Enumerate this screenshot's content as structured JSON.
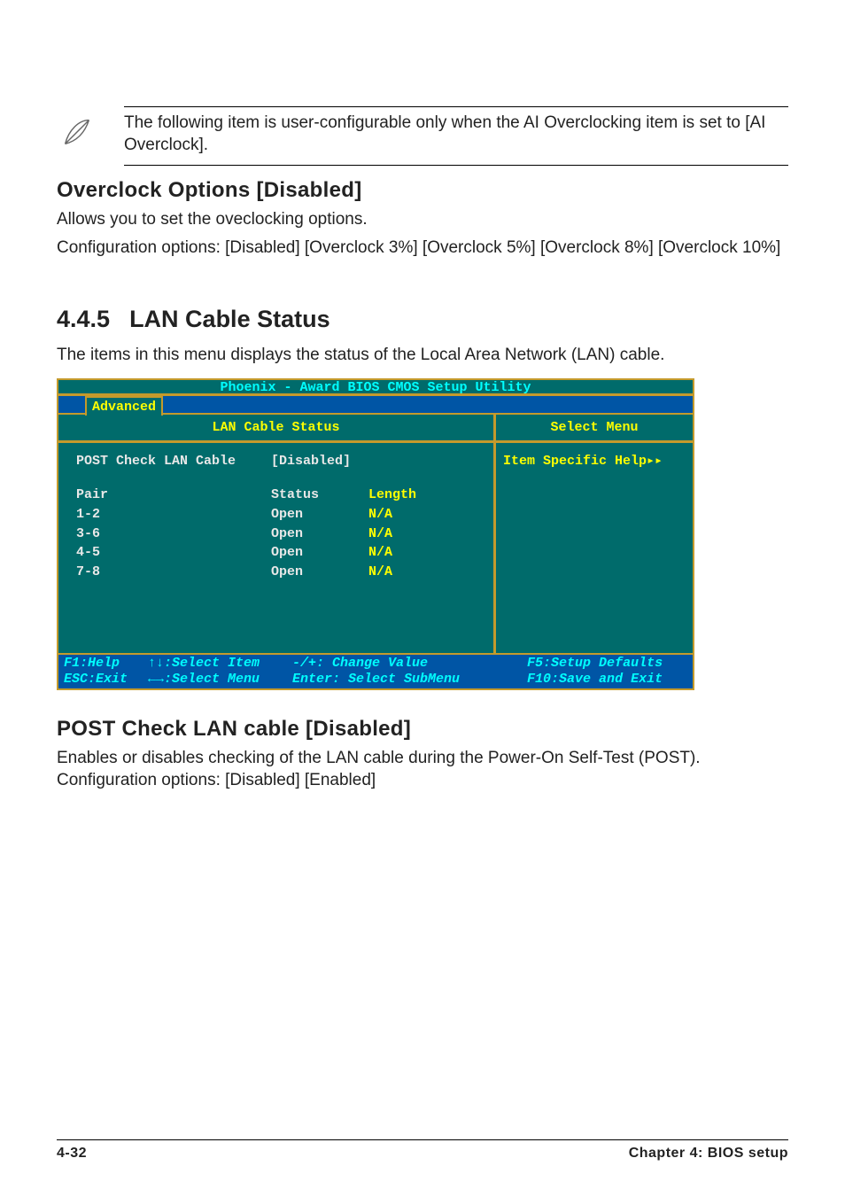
{
  "note": {
    "text": "The following item is user-configurable only when the AI Overclocking item is set to [AI Overclock]."
  },
  "overclock": {
    "heading": "Overclock Options [Disabled]",
    "body1": "Allows you to set the oveclocking options.",
    "body2": "Configuration options: [Disabled] [Overclock 3%] [Overclock 5%] [Overclock 8%] [Overclock 10%]"
  },
  "section": {
    "num": "4.4.5",
    "title": "LAN Cable Status",
    "intro": "The items in this menu displays the status of the Local Area Network (LAN) cable."
  },
  "bios": {
    "top": "Phoenix - Award BIOS CMOS Setup Utility",
    "active_tab": "Advanced",
    "left_header": "LAN Cable Status",
    "right_header": "Select Menu",
    "help_label": "Item Specific Help▸▸",
    "setting": {
      "name": "POST Check LAN Cable",
      "value": "[Disabled]"
    },
    "table": {
      "head": {
        "pair": "Pair",
        "status": "Status",
        "length": "Length"
      },
      "rows": [
        {
          "pair": "1-2",
          "status": "Open",
          "length": "N/A"
        },
        {
          "pair": "3-6",
          "status": "Open",
          "length": "N/A"
        },
        {
          "pair": "4-5",
          "status": "Open",
          "length": "N/A"
        },
        {
          "pair": "7-8",
          "status": "Open",
          "length": "N/A"
        }
      ]
    },
    "footer": {
      "f1": "F1:Help",
      "esc": "ESC:Exit",
      "sel_item": "↑↓:Select Item",
      "sel_menu": "←→:Select Menu",
      "change": "-/+: Change Value",
      "enter": "Enter: Select SubMenu",
      "f5": "F5:Setup Defaults",
      "f10": "F10:Save and Exit"
    }
  },
  "post_check": {
    "heading": "POST Check LAN cable [Disabled]",
    "body": "Enables or disables checking of the LAN cable during the Power-On Self-Test (POST). Configuration options: [Disabled] [Enabled]"
  },
  "page_footer": {
    "left": "4-32",
    "right": "Chapter 4: BIOS setup"
  },
  "chart_data": {
    "type": "table",
    "title": "LAN Cable Status",
    "columns": [
      "Pair",
      "Status",
      "Length"
    ],
    "rows": [
      [
        "1-2",
        "Open",
        "N/A"
      ],
      [
        "3-6",
        "Open",
        "N/A"
      ],
      [
        "4-5",
        "Open",
        "N/A"
      ],
      [
        "7-8",
        "Open",
        "N/A"
      ]
    ],
    "setting": {
      "POST Check LAN Cable": "[Disabled]"
    }
  }
}
